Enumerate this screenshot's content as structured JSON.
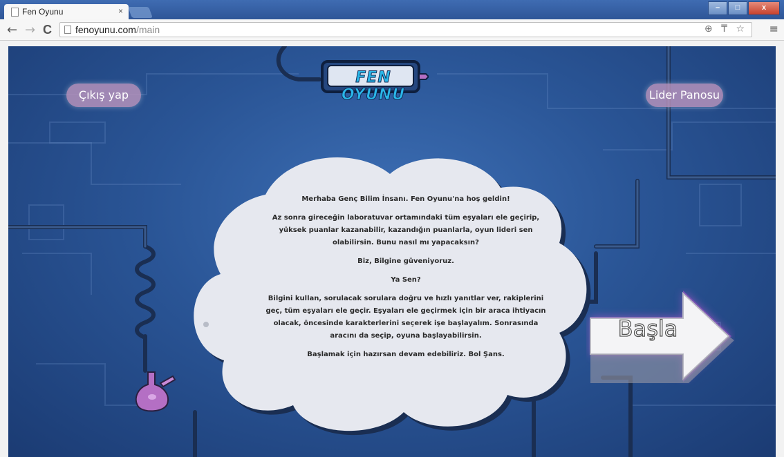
{
  "browser": {
    "tab_title": "Fen Oyunu",
    "tab_close": "×",
    "back": "←",
    "forward": "→",
    "reload": "C",
    "url_host": "fenoyunu.com",
    "url_path": "/main",
    "omnibox_icons": "⊕ ₸ ☆",
    "menu": "≡",
    "window_buttons": {
      "minimize": "–",
      "maximize": "□",
      "close": "x"
    }
  },
  "game": {
    "logo": "FEN OYUNU",
    "exit_button": "Çıkış yap",
    "leaderboard_button": "Lider Panosu",
    "start_button": "Başla",
    "message": {
      "greeting": "Merhaba Genç Bilim İnsanı. Fen Oyunu'na hoş geldin!",
      "p1": "Az sonra gireceğin laboratuvar ortamındaki tüm eşyaları ele geçirip, yüksek puanlar kazanabilir, kazandığın puanlarla, oyun lideri sen olabilirsin. Bunu nasıl mı yapacaksın?",
      "p2": "Biz, Bilgine güveniyoruz.",
      "p3": "Ya Sen?",
      "p4": "Bilgini kullan, sorulacak sorulara doğru ve hızlı yanıtlar ver, rakiplerini geç, tüm eşyaları ele geçir. Eşyaları ele geçirmek için bir araca ihtiyacın olacak, öncesinde karakterlerini seçerek işe başlayalım. Sonrasında aracını da seçip, oyuna başlayabilirsin.",
      "p5": "Başlamak için hazırsan devam edebiliriz. Bol Şans."
    }
  },
  "colors": {
    "background": "#2a5596",
    "button_fill": "#be96be",
    "cloud": "#e6e8ef",
    "flask": "#b46fc4"
  }
}
